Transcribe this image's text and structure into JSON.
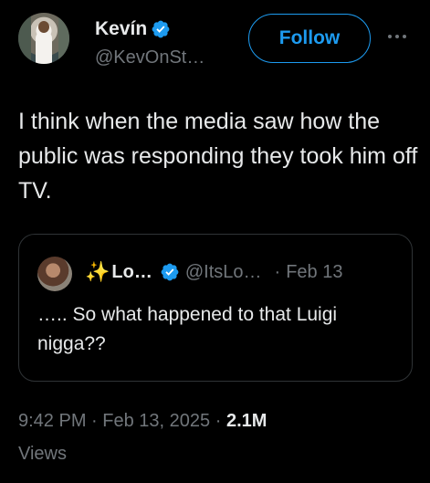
{
  "author": {
    "name": "Kevín",
    "handle": "@KevOnSt…",
    "verified": true
  },
  "follow_label": "Follow",
  "more_icon": "more-horizontal-icon",
  "tweet": {
    "text": "I think when the media saw how the public was responding they took him off TV."
  },
  "quote": {
    "sparkle": "✨",
    "name": "Lo…",
    "handle": "@ItsLo…",
    "separator": "·",
    "date": "Feb 13",
    "verified": true,
    "text": "….. So what happened to that Luigi nigga??"
  },
  "meta": {
    "time": "9:42 PM",
    "dot1": "·",
    "date": "Feb 13, 2025",
    "dot2": "·",
    "views_count": "2.1M",
    "views_label": "Views"
  },
  "colors": {
    "background": "#000000",
    "accent": "#1d9bf0",
    "muted": "#71767b",
    "text": "#e7e9ea"
  }
}
